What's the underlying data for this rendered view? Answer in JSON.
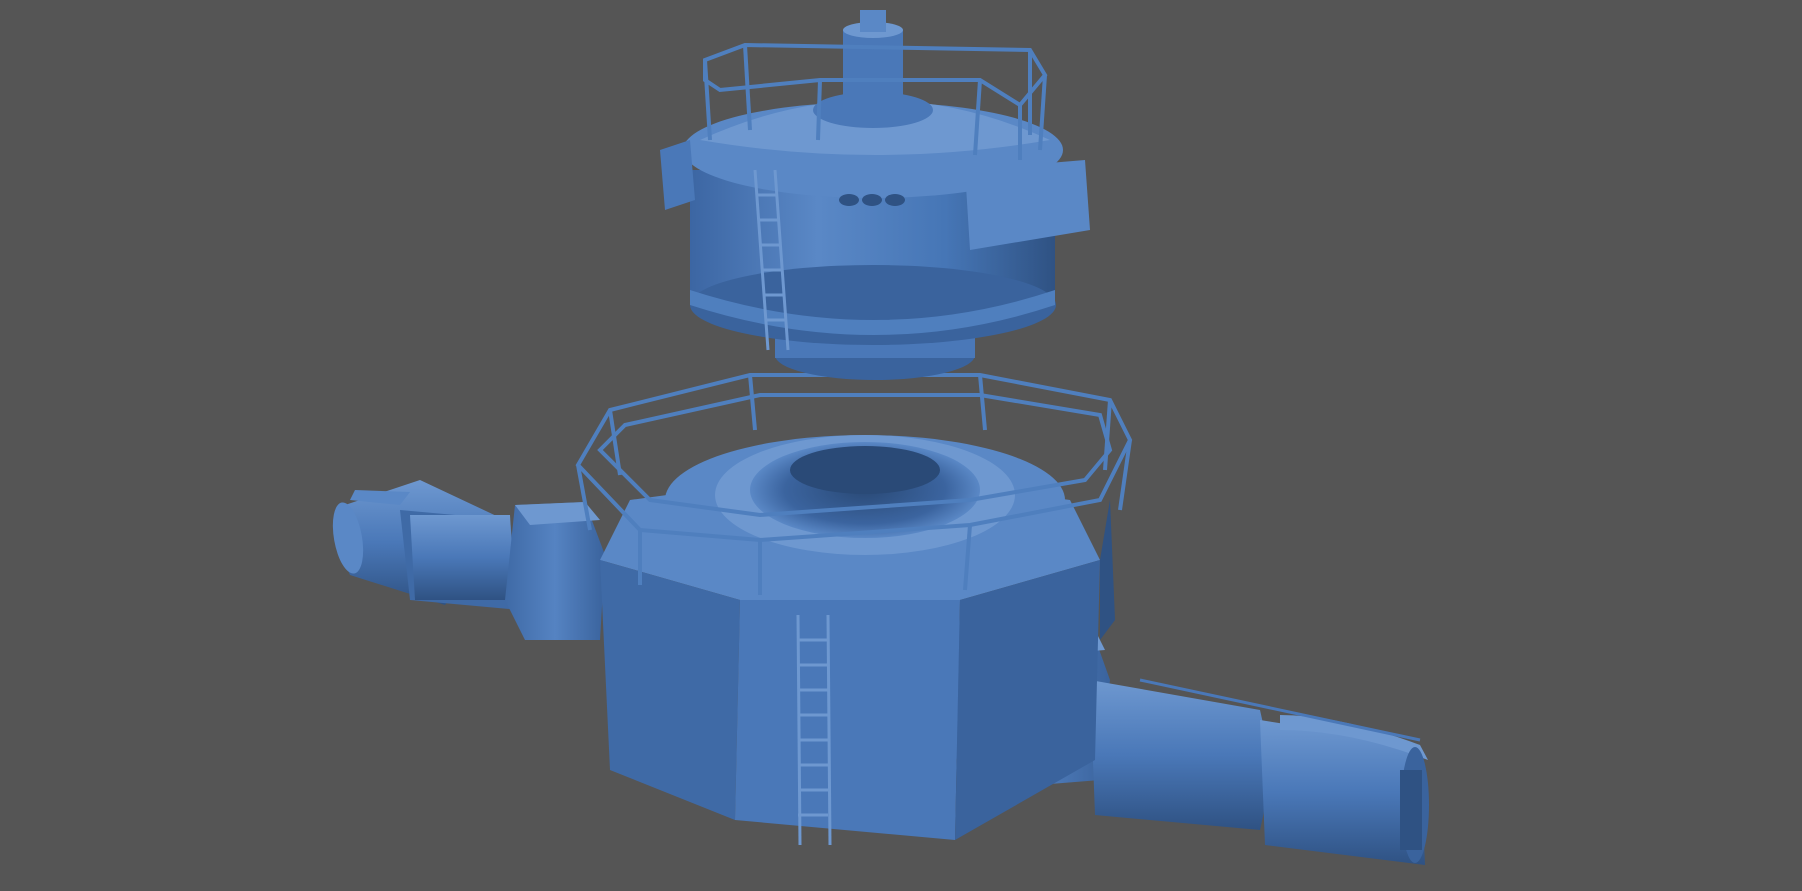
{
  "scene": {
    "description_visible_text": "",
    "background_color": "#555555",
    "model_color": "#4a78b8",
    "model_shadow_color": "#2f5283",
    "model_highlight_color": "#6e98d0",
    "model_dark_color": "#1f3a60",
    "subject": "render-of-blue-industrial-machine"
  }
}
